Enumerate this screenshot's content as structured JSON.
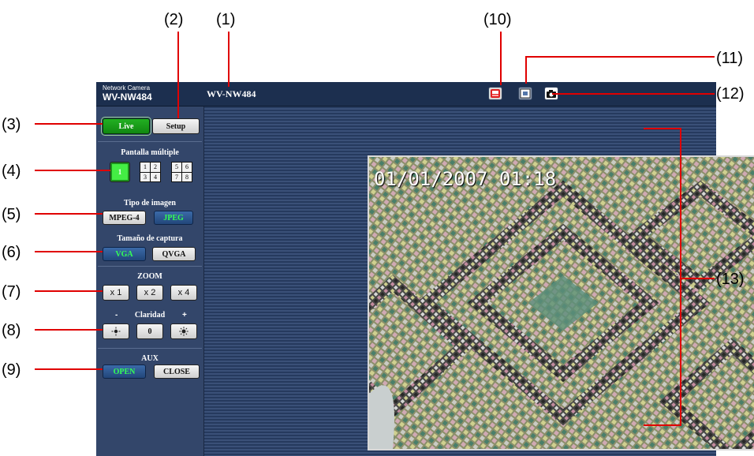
{
  "callouts": {
    "c1": "(1)",
    "c2": "(2)",
    "c3": "(3)",
    "c4": "(4)",
    "c5": "(5)",
    "c6": "(6)",
    "c7": "(7)",
    "c8": "(8)",
    "c9": "(9)",
    "c10": "(10)",
    "c11": "(11)",
    "c12": "(12)",
    "c13": "(13)"
  },
  "header": {
    "brand_small": "Network Camera",
    "brand_model": "WV-NW484",
    "title": "WV-NW484",
    "icons": [
      "recording-icon",
      "fullscreen-icon",
      "snapshot-camera-icon"
    ]
  },
  "sidebar": {
    "live_label": "Live",
    "setup_label": "Setup",
    "multiscreen_title": "Pantalla múltiple",
    "single_label": "1",
    "quad1": [
      "1",
      "2",
      "3",
      "4"
    ],
    "quad2": [
      "5",
      "6",
      "7",
      "8"
    ],
    "image_type_title": "Tipo de imagen",
    "mpeg4_label": "MPEG-4",
    "jpeg_label": "JPEG",
    "capture_size_title": "Tamaño de captura",
    "vga_label": "VGA",
    "qvga_label": "QVGA",
    "zoom_title": "ZOOM",
    "zoom_x1": "x 1",
    "zoom_x2": "x 2",
    "zoom_x4": "x 4",
    "brightness_minus": "-",
    "brightness_title": "Claridad",
    "brightness_plus": "+",
    "brightness_reset": "0",
    "aux_title": "AUX",
    "open_label": "OPEN",
    "close_label": "CLOSE"
  },
  "video": {
    "timestamp": "01/01/2007 01:18"
  },
  "colors": {
    "callout_line": "#e00000",
    "live_green": "#22b022",
    "active_text_green": "#33ff55",
    "panel_navy": "#2a3f63"
  }
}
